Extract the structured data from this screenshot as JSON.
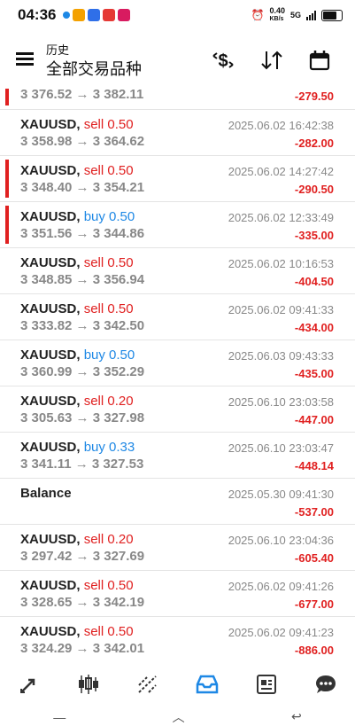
{
  "status": {
    "time": "04:36",
    "net_speed": "0.40",
    "net_unit": "KB/s",
    "net_type": "5G"
  },
  "appbar": {
    "subtitle": "历史",
    "title": "全部交易品种",
    "icons": [
      "menu-icon",
      "currency-icon",
      "sort-icon",
      "calendar-icon"
    ]
  },
  "trades": [
    {
      "symbol": "",
      "side": "",
      "side_class": "",
      "volume": "",
      "prices": "3 376.52 → 3 382.11",
      "time": "",
      "pl": "-279.50",
      "flag": true,
      "first": true
    },
    {
      "symbol": "XAUUSD,",
      "side": "sell",
      "side_class": "side-sell",
      "volume": "0.50",
      "prices": "3 358.98 → 3 364.62",
      "time": "2025.06.02 16:42:38",
      "pl": "-282.00",
      "flag": false
    },
    {
      "symbol": "XAUUSD,",
      "side": "sell",
      "side_class": "side-sell",
      "volume": "0.50",
      "prices": "3 348.40 → 3 354.21",
      "time": "2025.06.02 14:27:42",
      "pl": "-290.50",
      "flag": true
    },
    {
      "symbol": "XAUUSD,",
      "side": "buy",
      "side_class": "side-buy",
      "volume": "0.50",
      "prices": "3 351.56 → 3 344.86",
      "time": "2025.06.02 12:33:49",
      "pl": "-335.00",
      "flag": true
    },
    {
      "symbol": "XAUUSD,",
      "side": "sell",
      "side_class": "side-sell",
      "volume": "0.50",
      "prices": "3 348.85 → 3 356.94",
      "time": "2025.06.02 10:16:53",
      "pl": "-404.50",
      "flag": false
    },
    {
      "symbol": "XAUUSD,",
      "side": "sell",
      "side_class": "side-sell",
      "volume": "0.50",
      "prices": "3 333.82 → 3 342.50",
      "time": "2025.06.02 09:41:33",
      "pl": "-434.00",
      "flag": false
    },
    {
      "symbol": "XAUUSD,",
      "side": "buy",
      "side_class": "side-buy",
      "volume": "0.50",
      "prices": "3 360.99 → 3 352.29",
      "time": "2025.06.03 09:43:33",
      "pl": "-435.00",
      "flag": false
    },
    {
      "symbol": "XAUUSD,",
      "side": "sell",
      "side_class": "side-sell",
      "volume": "0.20",
      "prices": "3 305.63 → 3 327.98",
      "time": "2025.06.10 23:03:58",
      "pl": "-447.00",
      "flag": false
    },
    {
      "symbol": "XAUUSD,",
      "side": "buy",
      "side_class": "side-buy",
      "volume": "0.33",
      "prices": "3 341.11 → 3 327.53",
      "time": "2025.06.10 23:03:47",
      "pl": "-448.14",
      "flag": false
    },
    {
      "symbol": "Balance",
      "side": "",
      "side_class": "",
      "volume": "",
      "prices": "",
      "time": "2025.05.30 09:41:30",
      "pl": "-537.00",
      "flag": false
    },
    {
      "symbol": "XAUUSD,",
      "side": "sell",
      "side_class": "side-sell",
      "volume": "0.20",
      "prices": "3 297.42 → 3 327.69",
      "time": "2025.06.10 23:04:36",
      "pl": "-605.40",
      "flag": false
    },
    {
      "symbol": "XAUUSD,",
      "side": "sell",
      "side_class": "side-sell",
      "volume": "0.50",
      "prices": "3 328.65 → 3 342.19",
      "time": "2025.06.02 09:41:26",
      "pl": "-677.00",
      "flag": false
    },
    {
      "symbol": "XAUUSD,",
      "side": "sell",
      "side_class": "side-sell",
      "volume": "0.50",
      "prices": "3 324.29 → 3 342.01",
      "time": "2025.06.02 09:41:23",
      "pl": "-886.00",
      "flag": false
    }
  ],
  "bottom_nav": [
    {
      "name": "quotes-icon",
      "glyph": "⇗",
      "active": false
    },
    {
      "name": "chart-icon",
      "glyph": "▮▮",
      "active": false
    },
    {
      "name": "trade-icon",
      "glyph": "⤢",
      "active": false
    },
    {
      "name": "history-icon",
      "glyph": "▭",
      "active": true
    },
    {
      "name": "news-icon",
      "glyph": "▤",
      "active": false
    },
    {
      "name": "chat-icon",
      "glyph": "●",
      "active": false
    }
  ],
  "system_nav": [
    "—",
    "︿",
    "↩"
  ],
  "colors": {
    "loss": "#e02020",
    "buy": "#1e88e5",
    "active": "#1e88e5"
  }
}
